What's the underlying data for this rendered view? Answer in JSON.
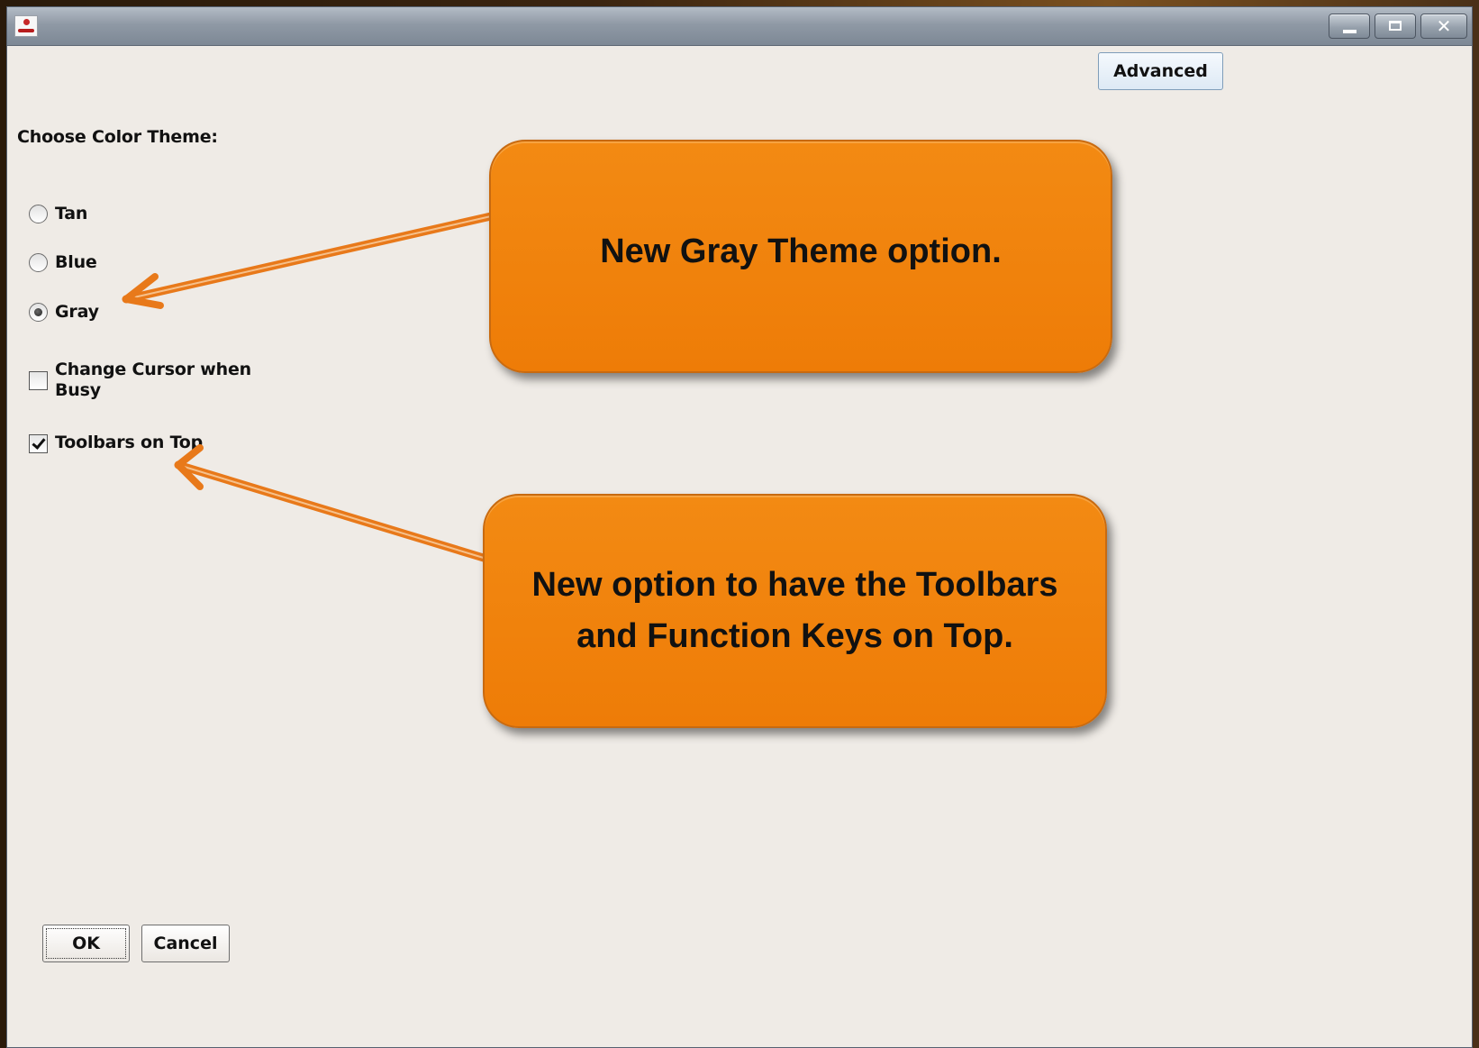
{
  "window": {
    "controls": {
      "minimize": "minimize",
      "maximize": "maximize",
      "close": "✕"
    }
  },
  "advanced_button": "Advanced",
  "theme": {
    "label": "Choose Color Theme:",
    "options": [
      "Tan",
      "Blue",
      "Gray"
    ],
    "selected": "Gray"
  },
  "checkboxes": {
    "change_cursor": {
      "label_line1": "Change Cursor when",
      "label_line2": "Busy",
      "checked": false
    },
    "toolbars_on_top": {
      "label": "Toolbars on Top",
      "checked": true
    }
  },
  "buttons": {
    "ok": "OK",
    "cancel": "Cancel"
  },
  "callouts": {
    "gray_theme": "New Gray Theme option.",
    "toolbars": "New option to have the Toolbars and Function Keys on Top."
  },
  "colors": {
    "callout_orange": "#f08209",
    "arrow_orange": "#e8791a",
    "dialog_bg": "#efebe6"
  }
}
